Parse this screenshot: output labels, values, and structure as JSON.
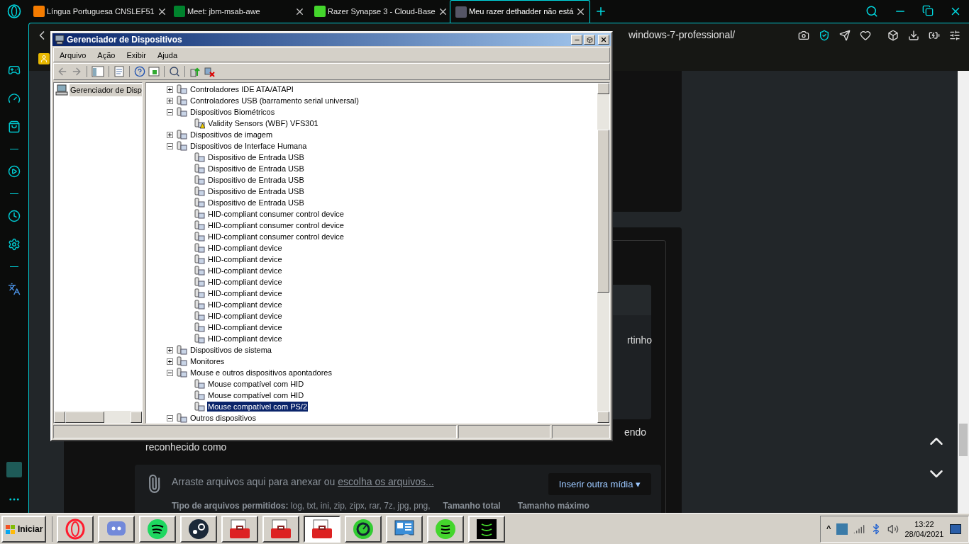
{
  "browser_tabs": [
    {
      "label": "Língua Portuguesa CNSLEF51",
      "selected": false
    },
    {
      "label": "Meet: jbm-msab-awe",
      "selected": false
    },
    {
      "label": "Razer Synapse 3 - Cloud-Base",
      "selected": false
    },
    {
      "label": "Meu razer dethadder não está",
      "selected": true
    }
  ],
  "address_bar": {
    "value": "windows-7-professional/"
  },
  "page": {
    "fragment_1": "rtinho",
    "fragment_2": "endo",
    "fragment_3": "reconhecido como",
    "attachments": {
      "prompt": "Arraste arquivos aqui para anexar ou ",
      "link": "escolha os arquivos...",
      "media_button": "Inserir outra mídia ▾",
      "allowed_types": "**Tipo de arquivos permitidos:** log, txt, ini, zip, zipx, rar, 7z, jpg, png,",
      "total_size": "Tamanho total",
      "max_size": "Tamanho máximo"
    }
  },
  "device_manager": {
    "title": "Gerenciador de Dispositivos",
    "menu": [
      "Arquivo",
      "Ação",
      "Exibir",
      "Ajuda"
    ],
    "console_tree": [
      {
        "label": "Gerenciador de Disp",
        "selected": true
      }
    ],
    "tree": [
      {
        "label": "Controladores IDE ATA/ATAPI",
        "expanded": false,
        "selected": false
      },
      {
        "label": "Controladores USB (barramento serial universal)",
        "expanded": false,
        "selected": false
      },
      {
        "label": "Dispositivos Biométricos",
        "expanded": true,
        "selected": false,
        "children": [
          {
            "label": "Validity Sensors (WBF) VFS301",
            "warning": true,
            "selected": false
          }
        ]
      },
      {
        "label": "Dispositivos de imagem",
        "expanded": false,
        "selected": false
      },
      {
        "label": "Dispositivos de Interface Humana",
        "expanded": true,
        "selected": false,
        "children": [
          {
            "label": "Dispositivo de Entrada USB",
            "warning": false,
            "selected": false
          },
          {
            "label": "Dispositivo de Entrada USB",
            "warning": false,
            "selected": false
          },
          {
            "label": "Dispositivo de Entrada USB",
            "warning": false,
            "selected": false
          },
          {
            "label": "Dispositivo de Entrada USB",
            "warning": false,
            "selected": false
          },
          {
            "label": "Dispositivo de Entrada USB",
            "warning": false,
            "selected": false
          },
          {
            "label": "HID-compliant consumer control device",
            "warning": false,
            "selected": false
          },
          {
            "label": "HID-compliant consumer control device",
            "warning": false,
            "selected": false
          },
          {
            "label": "HID-compliant consumer control device",
            "warning": false,
            "selected": false
          },
          {
            "label": "HID-compliant device",
            "warning": false,
            "selected": false
          },
          {
            "label": "HID-compliant device",
            "warning": false,
            "selected": false
          },
          {
            "label": "HID-compliant device",
            "warning": false,
            "selected": false
          },
          {
            "label": "HID-compliant device",
            "warning": false,
            "selected": false
          },
          {
            "label": "HID-compliant device",
            "warning": false,
            "selected": false
          },
          {
            "label": "HID-compliant device",
            "warning": false,
            "selected": false
          },
          {
            "label": "HID-compliant device",
            "warning": false,
            "selected": false
          },
          {
            "label": "HID-compliant device",
            "warning": false,
            "selected": false
          },
          {
            "label": "HID-compliant device",
            "warning": false,
            "selected": false
          }
        ]
      },
      {
        "label": "Dispositivos de sistema",
        "expanded": false,
        "selected": false
      },
      {
        "label": "Monitores",
        "expanded": false,
        "selected": false
      },
      {
        "label": "Mouse e outros dispositivos apontadores",
        "expanded": true,
        "selected": false,
        "children": [
          {
            "label": "Mouse compatível com HID",
            "warning": false,
            "selected": false
          },
          {
            "label": "Mouse compatível com HID",
            "warning": false,
            "selected": false
          },
          {
            "label": "Mouse compatível com PS/2",
            "warning": false,
            "selected": true
          }
        ]
      },
      {
        "label": "Outros dispositivos",
        "expanded": true,
        "selected": false
      }
    ]
  },
  "taskbar": {
    "start": "Iniciar",
    "apps": [
      {
        "selected": false
      },
      {
        "selected": false
      },
      {
        "selected": false
      },
      {
        "selected": false
      },
      {
        "selected": false
      },
      {
        "selected": false
      },
      {
        "selected": true
      },
      {
        "selected": false
      },
      {
        "selected": false
      },
      {
        "selected": false
      },
      {
        "selected": false
      }
    ],
    "tray_chevron": "^",
    "time": "13:22",
    "date": "28/04/2021"
  }
}
